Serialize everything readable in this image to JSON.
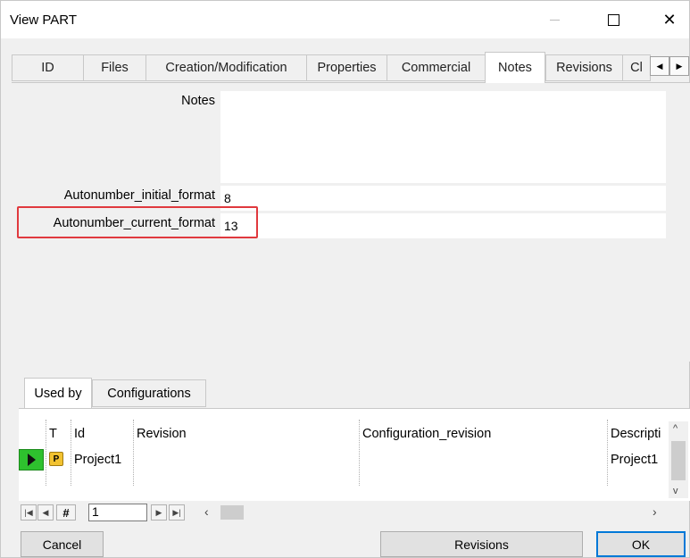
{
  "window": {
    "title": "View PART"
  },
  "tabs": [
    {
      "label": "ID"
    },
    {
      "label": "Files"
    },
    {
      "label": "Creation/Modification"
    },
    {
      "label": "Properties"
    },
    {
      "label": "Commercial"
    },
    {
      "label": "Notes"
    },
    {
      "label": "Revisions"
    },
    {
      "label": "Cl"
    }
  ],
  "active_tab": "Notes",
  "form": {
    "notes_label": "Notes",
    "notes_value": "",
    "initial_label": "Autonumber_initial_format",
    "initial_value": "8",
    "current_label": "Autonumber_current_format",
    "current_value": "13"
  },
  "subtabs": [
    {
      "label": "Used by"
    },
    {
      "label": "Configurations"
    }
  ],
  "grid": {
    "columns": [
      "T",
      "Id",
      "Revision",
      "Configuration_revision",
      "Descripti"
    ],
    "rows": [
      {
        "type_icon": "P",
        "id": "Project1",
        "revision": "",
        "configuration_revision": "",
        "description": "Project1"
      }
    ]
  },
  "navigator": {
    "hash": "#",
    "record": "1"
  },
  "buttons": {
    "cancel": "Cancel",
    "revisions": "Revisions",
    "ok": "OK"
  },
  "colors": {
    "highlight": "#e0393e",
    "row_indicator": "#2ec12e",
    "ok_border": "#0078d7"
  }
}
